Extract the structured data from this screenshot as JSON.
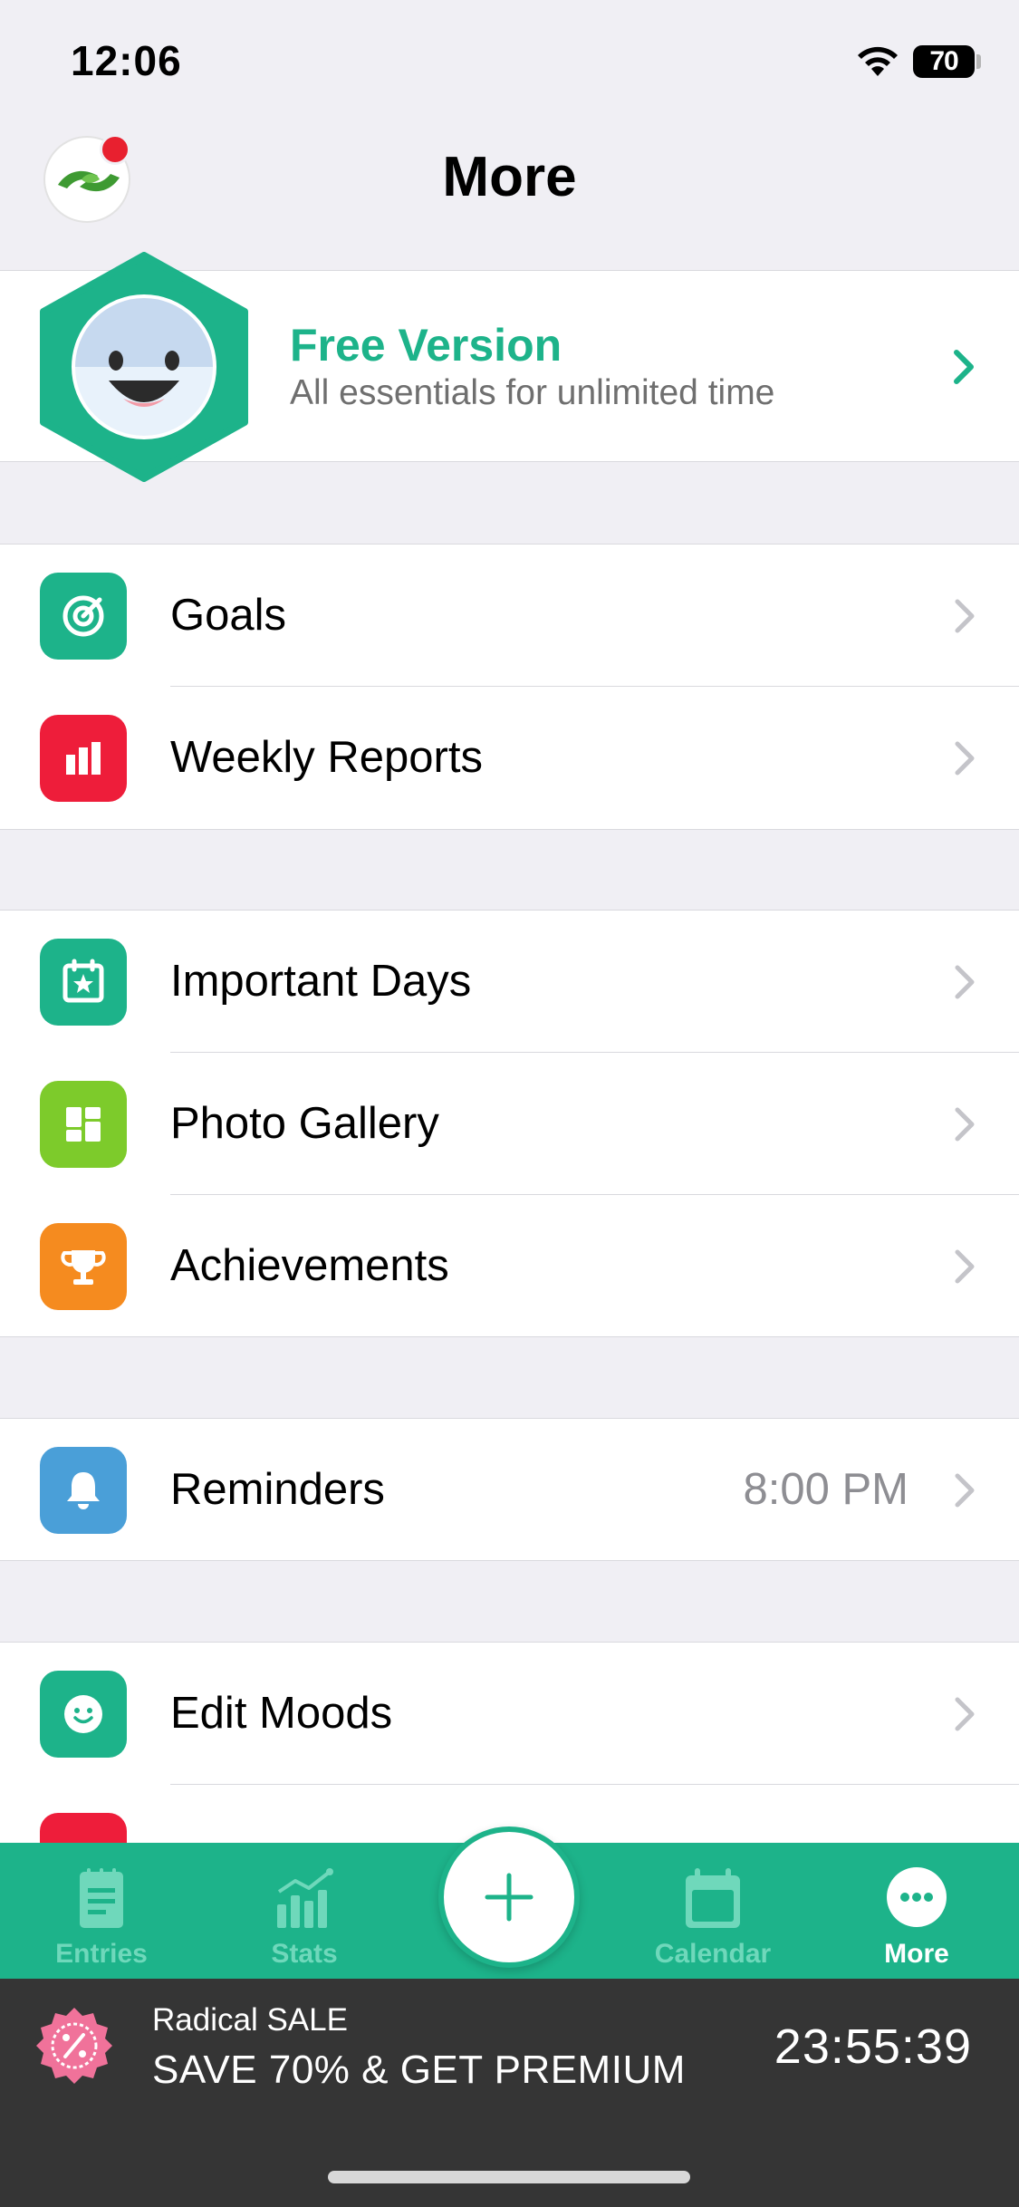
{
  "status_bar": {
    "time": "12:06",
    "battery": "70"
  },
  "header": {
    "title": "More"
  },
  "promo": {
    "title": "Free Version",
    "subtitle": "All essentials for unlimited time"
  },
  "groups": {
    "g1": [
      {
        "label": "Goals",
        "icon": "target-icon",
        "color": "#1db38a"
      },
      {
        "label": "Weekly Reports",
        "icon": "bar-chart-icon",
        "color": "#ee1d3a"
      }
    ],
    "g2": [
      {
        "label": "Important Days",
        "icon": "calendar-star-icon",
        "color": "#1db38a"
      },
      {
        "label": "Photo Gallery",
        "icon": "gallery-grid-icon",
        "color": "#7dcb2b"
      },
      {
        "label": "Achievements",
        "icon": "trophy-icon",
        "color": "#f58b1f"
      }
    ],
    "g3": [
      {
        "label": "Reminders",
        "value": "8:00 PM",
        "icon": "bell-icon",
        "color": "#4a9fd8"
      }
    ],
    "g4": [
      {
        "label": "Edit Moods",
        "icon": "smile-icon",
        "color": "#1db38a"
      }
    ]
  },
  "tabbar": {
    "entries": "Entries",
    "stats": "Stats",
    "calendar": "Calendar",
    "more": "More",
    "active": "More"
  },
  "sale": {
    "small": "Radical SALE",
    "big": "SAVE 70% & GET PREMIUM",
    "timer": "23:55:39"
  }
}
